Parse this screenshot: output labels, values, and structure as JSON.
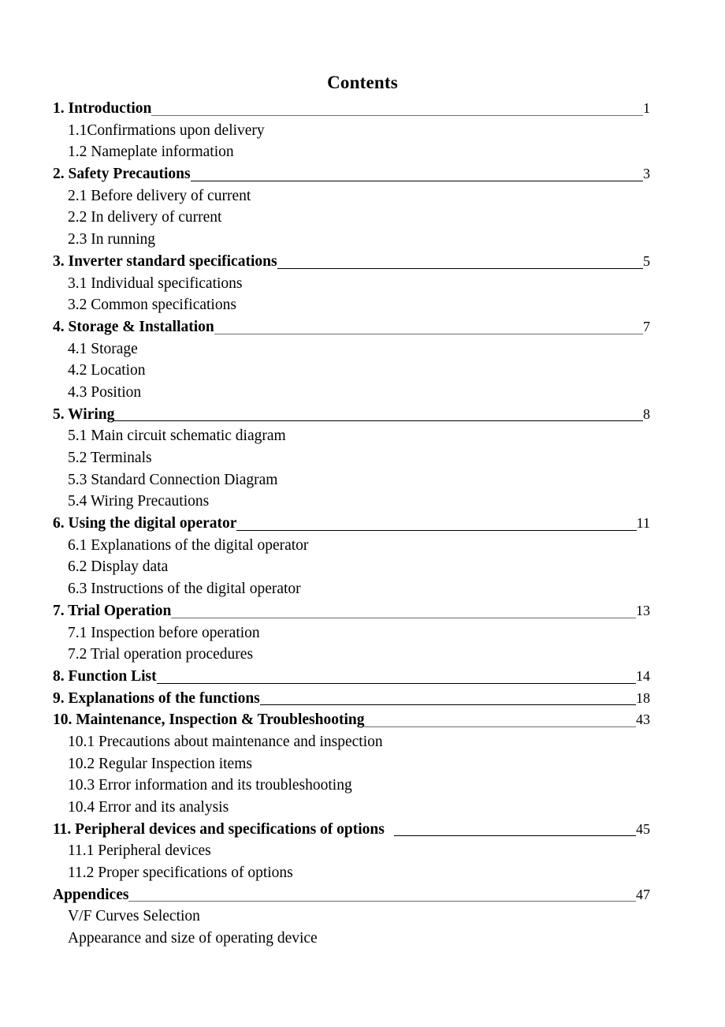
{
  "document": {
    "title": "Contents"
  },
  "toc": {
    "entries": [
      {
        "label": "1. Introduction",
        "page": "1",
        "level": 1,
        "leader": "faint",
        "gap": false
      },
      {
        "label": "1.1Confirmations upon delivery",
        "page": "",
        "level": 2,
        "leader": "none",
        "gap": false
      },
      {
        "label": "1.2 Nameplate information",
        "page": "",
        "level": 2,
        "leader": "none",
        "gap": false
      },
      {
        "label": "2. Safety Precautions",
        "page": "3",
        "level": 1,
        "leader": "solid",
        "gap": false
      },
      {
        "label": "2.1 Before delivery of current",
        "page": "",
        "level": 2,
        "leader": "none",
        "gap": false
      },
      {
        "label": "2.2 In delivery of current",
        "page": "",
        "level": 2,
        "leader": "none",
        "gap": false
      },
      {
        "label": "2.3 In running",
        "page": "",
        "level": 2,
        "leader": "none",
        "gap": false
      },
      {
        "label": "3. Inverter standard specifications",
        "page": "5",
        "level": 1,
        "leader": "solid",
        "gap": false
      },
      {
        "label": "3.1 Individual specifications",
        "page": "",
        "level": 2,
        "leader": "none",
        "gap": false
      },
      {
        "label": "3.2 Common specifications",
        "page": "",
        "level": 2,
        "leader": "none",
        "gap": false
      },
      {
        "label": "4. Storage & Installation",
        "page": "7",
        "level": 1,
        "leader": "faint",
        "gap": false
      },
      {
        "label": "4.1 Storage",
        "page": "",
        "level": 2,
        "leader": "none",
        "gap": false
      },
      {
        "label": "4.2 Location",
        "page": "",
        "level": 2,
        "leader": "none",
        "gap": false
      },
      {
        "label": "4.3 Position",
        "page": "",
        "level": 2,
        "leader": "none",
        "gap": false
      },
      {
        "label": "5. Wiring",
        "page": "8",
        "level": 1,
        "leader": "solid",
        "gap": false
      },
      {
        "label": "5.1 Main circuit schematic diagram",
        "page": "",
        "level": 2,
        "leader": "none",
        "gap": false
      },
      {
        "label": "5.2 Terminals",
        "page": "",
        "level": 2,
        "leader": "none",
        "gap": false
      },
      {
        "label": "5.3 Standard Connection Diagram",
        "page": "",
        "level": 2,
        "leader": "none",
        "gap": false
      },
      {
        "label": "5.4 Wiring Precautions",
        "page": "",
        "level": 2,
        "leader": "none",
        "gap": false
      },
      {
        "label": "6. Using the digital operator",
        "page": "11",
        "level": 1,
        "leader": "solid",
        "gap": false
      },
      {
        "label": "6.1 Explanations of the digital operator",
        "page": "",
        "level": 2,
        "leader": "none",
        "gap": false
      },
      {
        "label": "6.2 Display data",
        "page": "",
        "level": 2,
        "leader": "none",
        "gap": false
      },
      {
        "label": "6.3 Instructions of the digital operator",
        "page": "",
        "level": 2,
        "leader": "none",
        "gap": false
      },
      {
        "label": "7. Trial Operation",
        "page": "13",
        "level": 1,
        "leader": "faint",
        "gap": false
      },
      {
        "label": "7.1 Inspection before operation",
        "page": "",
        "level": 2,
        "leader": "none",
        "gap": false
      },
      {
        "label": "7.2 Trial operation procedures",
        "page": "",
        "level": 2,
        "leader": "none",
        "gap": false
      },
      {
        "label": "8. Function List",
        "page": "14",
        "level": 1,
        "leader": "solid",
        "gap": false
      },
      {
        "label": "9. Explanations of the functions",
        "page": "18",
        "level": 1,
        "leader": "solid",
        "gap": false
      },
      {
        "label": "10. Maintenance, Inspection & Troubleshooting",
        "page": "43",
        "level": 1,
        "leader": "faint",
        "gap": false
      },
      {
        "label": "10.1 Precautions about maintenance and inspection",
        "page": "",
        "level": 2,
        "leader": "none",
        "gap": false
      },
      {
        "label": "10.2 Regular Inspection items",
        "page": "",
        "level": 2,
        "leader": "none",
        "gap": false
      },
      {
        "label": "10.3 Error information and its troubleshooting",
        "page": "",
        "level": 2,
        "leader": "none",
        "gap": false
      },
      {
        "label": "10.4 Error and its analysis",
        "page": "",
        "level": 2,
        "leader": "none",
        "gap": false
      },
      {
        "label": "11. Peripheral devices and specifications of options",
        "page": "45",
        "level": 1,
        "leader": "solid",
        "gap": true
      },
      {
        "label": "11.1 Peripheral devices",
        "page": "",
        "level": 2,
        "leader": "none",
        "gap": false
      },
      {
        "label": "11.2 Proper specifications of options",
        "page": "",
        "level": 2,
        "leader": "none",
        "gap": false
      },
      {
        "label": "Appendices",
        "page": "47",
        "level": 1,
        "leader": "faint",
        "gap": false
      },
      {
        "label": "V/F Curves Selection",
        "page": "",
        "level": 2,
        "leader": "none",
        "gap": false
      },
      {
        "label": "Appearance and size of operating device",
        "page": "",
        "level": 2,
        "leader": "none",
        "gap": false
      }
    ]
  }
}
